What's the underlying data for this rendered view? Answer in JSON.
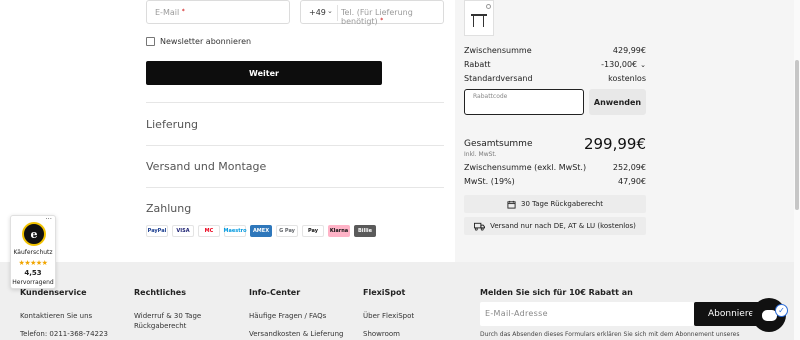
{
  "contact": {
    "email_placeholder": "E-Mail",
    "country_code": "+49",
    "phone_placeholder": "Tel. (Für Lieferung benötigt)",
    "required_mark": "*",
    "newsletter_label": "Newsletter abonnieren",
    "submit_label": "Weiter"
  },
  "sections": [
    {
      "title": "Lieferung"
    },
    {
      "title": "Versand und Montage"
    },
    {
      "title": "Zahlung"
    }
  ],
  "payment_methods": [
    {
      "label": "PayPal",
      "bg": "#ffffff",
      "fg": "#1a3d8f"
    },
    {
      "label": "VISA",
      "bg": "#ffffff",
      "fg": "#1a1f71"
    },
    {
      "label": "MC",
      "bg": "#ffffff",
      "fg": "#eb001b"
    },
    {
      "label": "Maestro",
      "bg": "#ffffff",
      "fg": "#0099df"
    },
    {
      "label": "AMEX",
      "bg": "#2e77bb",
      "fg": "#ffffff"
    },
    {
      "label": "G Pay",
      "bg": "#ffffff",
      "fg": "#5f6368"
    },
    {
      "label": "Pay",
      "bg": "#ffffff",
      "fg": "#111111"
    },
    {
      "label": "Klarna",
      "bg": "#ffb3c7",
      "fg": "#111111"
    },
    {
      "label": "Billie",
      "bg": "#5a5a5a",
      "fg": "#ffffff"
    }
  ],
  "trust_badge": {
    "seal_letter": "e",
    "label": "Käuferschutz",
    "stars": "★★★★★",
    "score": "4,53",
    "rating_text": "Hervorragend",
    "more": "···"
  },
  "summary": {
    "rows": [
      {
        "label": "Zwischensumme",
        "value": "429,99€"
      },
      {
        "label": "Rabatt",
        "value": "-130,00€",
        "has_chevron": true
      },
      {
        "label": "Standardversand",
        "value": "kostenlos"
      }
    ],
    "coupon_placeholder": "Rabattcode",
    "apply_label": "Anwenden",
    "total_label": "Gesamtsumme",
    "total_sub": "Inkl. MwSt.",
    "total_value": "299,99€",
    "net_rows": [
      {
        "label": "Zwischensumme (exkl. MwSt.)",
        "value": "252,09€"
      },
      {
        "label": "MwSt. (19%)",
        "value": "47,90€"
      }
    ],
    "info_boxes": [
      {
        "icon": "calendar-icon",
        "text": "30 Tage Rückgaberecht"
      },
      {
        "icon": "truck-icon",
        "text": "Versand nur nach DE, AT & LU (kostenlos)"
      }
    ]
  },
  "footer": {
    "columns": [
      {
        "heading": "Kundenservice",
        "links": [
          "Kontaktieren Sie uns",
          "Telefon: 0211-368-74223"
        ]
      },
      {
        "heading": "Rechtliches",
        "links": [
          "Widerruf & 30 Tage Rückgaberecht"
        ]
      },
      {
        "heading": "Info-Center",
        "links": [
          "Häufige Fragen / FAQs",
          "Versandkosten & Lieferung"
        ]
      },
      {
        "heading": "FlexiSpot",
        "links": [
          "Über FlexiSpot",
          "Showroom"
        ]
      }
    ],
    "newsletter": {
      "heading": "Melden Sie sich für 10€ Rabatt an",
      "placeholder": "E-Mail-Adresse",
      "button_label": "Abonnieren",
      "note": "Durch das Absenden dieses Formulars erklären Sie sich mit dem Abonnement unseres"
    }
  },
  "colors": {
    "primary_button": "#0d0d0d",
    "summary_bg": "#f5f5f5",
    "footer_bg": "#efefef",
    "star": "#f1a500"
  }
}
